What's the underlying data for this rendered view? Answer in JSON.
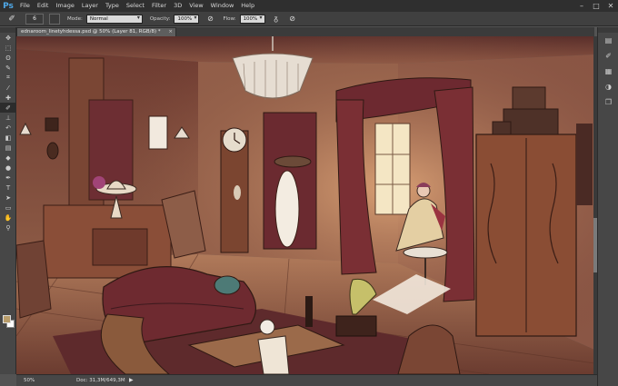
{
  "app": {
    "logo": "Ps"
  },
  "menu": [
    "File",
    "Edit",
    "Image",
    "Layer",
    "Type",
    "Select",
    "Filter",
    "3D",
    "View",
    "Window",
    "Help"
  ],
  "window_controls": {
    "minimize": "–",
    "maximize": "□",
    "close": "✕"
  },
  "options": {
    "brush_size": "6",
    "mode_label": "Mode:",
    "mode_value": "Normal",
    "opacity_label": "Opacity:",
    "opacity_value": "100%",
    "flow_label": "Flow:",
    "flow_value": "100%"
  },
  "document_tab": {
    "title": "ednaroom_linetyhdessa.psd @ 50% (Layer 81, RGB/8) *",
    "close": "×"
  },
  "status": {
    "zoom": "50%",
    "doc": "Doc: 31,3M/649,3M",
    "arrow": "▶"
  },
  "tools": [
    {
      "name": "move-tool-icon",
      "glyph": "✥"
    },
    {
      "name": "marquee-tool-icon",
      "glyph": "⬚"
    },
    {
      "name": "lasso-tool-icon",
      "glyph": "ʘ"
    },
    {
      "name": "quick-select-tool-icon",
      "glyph": "✎"
    },
    {
      "name": "crop-tool-icon",
      "glyph": "⌗"
    },
    {
      "name": "eyedropper-tool-icon",
      "glyph": "⁄"
    },
    {
      "name": "healing-tool-icon",
      "glyph": "✚"
    },
    {
      "name": "brush-tool-icon",
      "glyph": "✐"
    },
    {
      "name": "clone-stamp-tool-icon",
      "glyph": "⊥"
    },
    {
      "name": "history-brush-tool-icon",
      "glyph": "↶"
    },
    {
      "name": "eraser-tool-icon",
      "glyph": "◧"
    },
    {
      "name": "gradient-tool-icon",
      "glyph": "▤"
    },
    {
      "name": "blur-tool-icon",
      "glyph": "◆"
    },
    {
      "name": "dodge-tool-icon",
      "glyph": "●"
    },
    {
      "name": "pen-tool-icon",
      "glyph": "✒"
    },
    {
      "name": "type-tool-icon",
      "glyph": "T"
    },
    {
      "name": "path-select-tool-icon",
      "glyph": "➤"
    },
    {
      "name": "shape-tool-icon",
      "glyph": "▭"
    },
    {
      "name": "hand-tool-icon",
      "glyph": "✋"
    },
    {
      "name": "zoom-tool-icon",
      "glyph": "⚲"
    }
  ],
  "colors": {
    "foreground": "#b89c6a",
    "background": "#ffffff"
  },
  "right_panel_buttons": [
    {
      "name": "history-panel-icon",
      "glyph": "▤"
    },
    {
      "name": "brush-presets-panel-icon",
      "glyph": "✐"
    },
    {
      "name": "swatches-panel-icon",
      "glyph": "▦"
    },
    {
      "name": "adjustments-panel-icon",
      "glyph": "◑"
    },
    {
      "name": "layers-panel-icon",
      "glyph": "❐"
    }
  ]
}
